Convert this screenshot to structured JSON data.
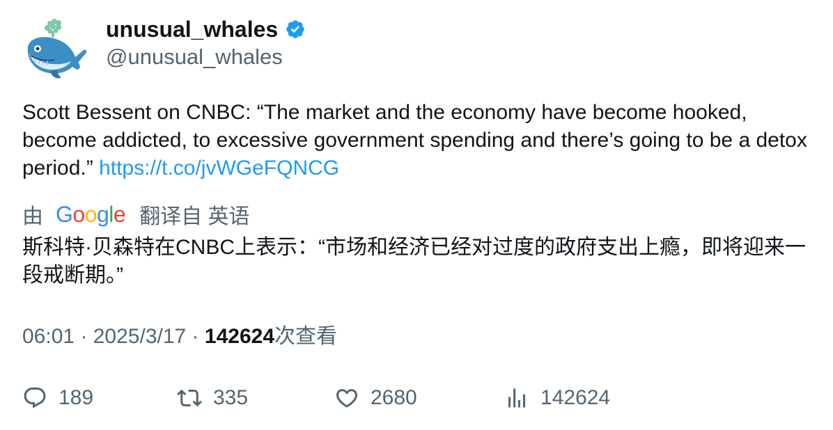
{
  "user": {
    "display_name": "unusual_whales",
    "handle": "@unusual_whales"
  },
  "tweet": {
    "text": "Scott Bessent on CNBC: “The market and the economy have become hooked, become addicted, to excessive government spending and there’s going to be a detox period.” ",
    "link": "https://t.co/jvWGeFQNCG"
  },
  "translation": {
    "prefix": "由",
    "logo_letters": [
      "G",
      "o",
      "o",
      "g",
      "l",
      "e"
    ],
    "suffix": "翻译自 英语",
    "text": "斯科特·贝森特在CNBC上表示：“市场和经济已经对过度的政府支出上瘾，即将迎来一段戒断期。”"
  },
  "meta": {
    "time": "06:01",
    "sep1": " · ",
    "date": "2025/3/17",
    "sep2": " · ",
    "views": "142624",
    "views_label": "次查看"
  },
  "actions": {
    "replies": "189",
    "retweets": "335",
    "likes": "2680",
    "views": "142624"
  },
  "colors": {
    "accent": "#1d9bf0",
    "secondary_text": "#536471",
    "primary_text": "#0f1419"
  }
}
